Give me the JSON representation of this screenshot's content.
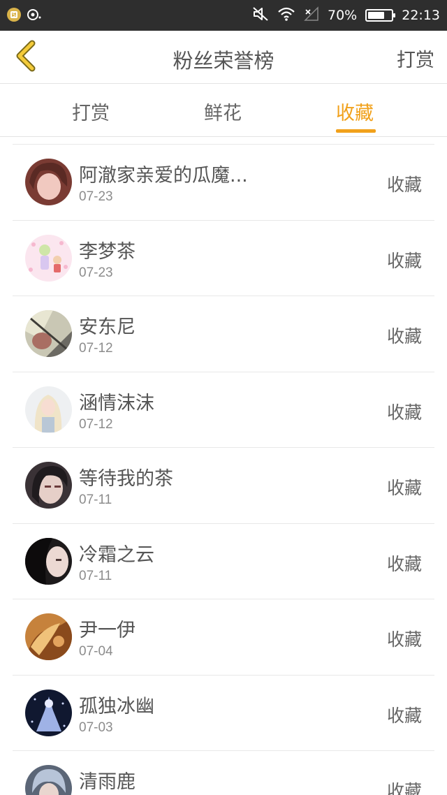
{
  "status_bar": {
    "battery_percent": "70%",
    "battery_level": 0.7,
    "time": "22:13"
  },
  "header": {
    "title": "粉丝荣誉榜",
    "right_action": "打赏"
  },
  "tabs": [
    {
      "label": "打赏",
      "active": false
    },
    {
      "label": "鲜花",
      "active": false
    },
    {
      "label": "收藏",
      "active": true
    }
  ],
  "colors": {
    "accent": "#f1a11b",
    "status_bar": "#2e2e2e"
  },
  "fans": [
    {
      "name": "阿澈家亲爱的瓜魔...",
      "date": "07-23",
      "action": "收藏"
    },
    {
      "name": "李梦茶",
      "date": "07-23",
      "action": "收藏"
    },
    {
      "name": "安东尼",
      "date": "07-12",
      "action": "收藏"
    },
    {
      "name": "涵情沫沫",
      "date": "07-12",
      "action": "收藏"
    },
    {
      "name": "等待我的茶",
      "date": "07-11",
      "action": "收藏"
    },
    {
      "name": "冷霜之云",
      "date": "07-11",
      "action": "收藏"
    },
    {
      "name": "尹一伊",
      "date": "07-04",
      "action": "收藏"
    },
    {
      "name": "孤独冰幽",
      "date": "07-03",
      "action": "收藏"
    },
    {
      "name": "清雨鹿",
      "date": "",
      "action": "收藏"
    }
  ]
}
